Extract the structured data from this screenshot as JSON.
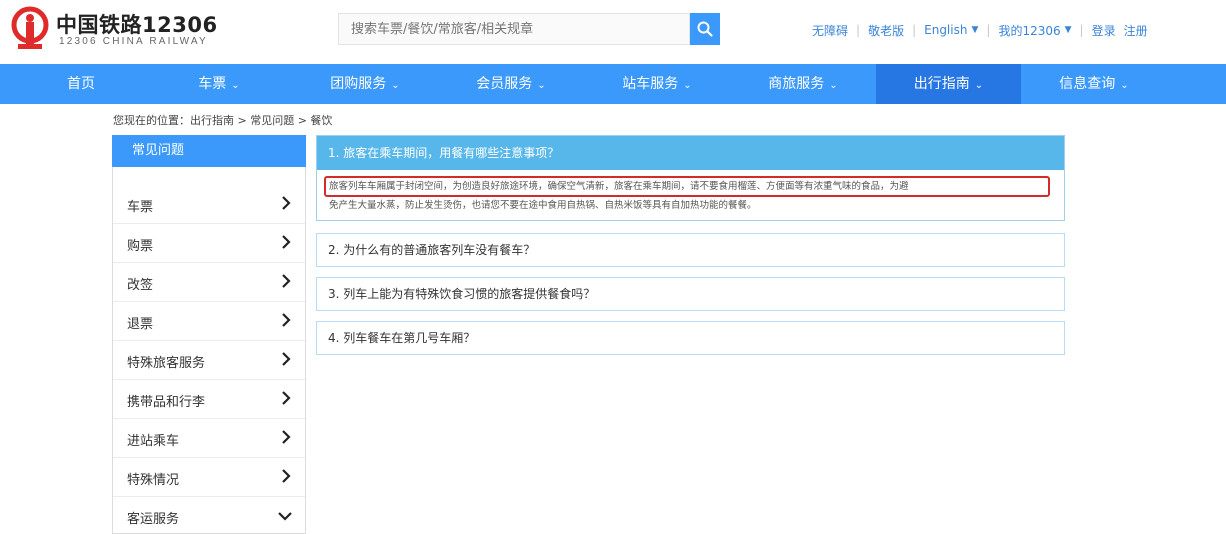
{
  "header": {
    "logo_cn": "中国铁路12306",
    "logo_en": "12306 CHINA RAILWAY",
    "search_placeholder": "搜索车票/餐饮/常旅客/相关规章",
    "links": [
      {
        "label": "无障碍",
        "dropdown": false
      },
      {
        "label": "敬老版",
        "dropdown": false
      },
      {
        "label": "English",
        "dropdown": true
      },
      {
        "label": "我的12306",
        "dropdown": true
      },
      {
        "label": "登录",
        "dropdown": false
      },
      {
        "label": "注册",
        "dropdown": false
      }
    ]
  },
  "nav": {
    "items": [
      {
        "label": "首页",
        "dropdown": false,
        "active": false
      },
      {
        "label": "车票",
        "dropdown": true,
        "active": false
      },
      {
        "label": "团购服务",
        "dropdown": true,
        "active": false
      },
      {
        "label": "会员服务",
        "dropdown": true,
        "active": false
      },
      {
        "label": "站车服务",
        "dropdown": true,
        "active": false
      },
      {
        "label": "商旅服务",
        "dropdown": true,
        "active": false
      },
      {
        "label": "出行指南",
        "dropdown": true,
        "active": true
      },
      {
        "label": "信息查询",
        "dropdown": true,
        "active": false
      }
    ],
    "caret": "⌄"
  },
  "breadcrumb": "您现在的位置：出行指南 > 常见问题 > 餐饮",
  "sidebar": {
    "title": "常见问题",
    "items": [
      {
        "label": "车票",
        "icon": "chevron-right-icon"
      },
      {
        "label": "购票",
        "icon": "chevron-right-icon"
      },
      {
        "label": "改签",
        "icon": "chevron-right-icon"
      },
      {
        "label": "退票",
        "icon": "chevron-right-icon"
      },
      {
        "label": "特殊旅客服务",
        "icon": "chevron-right-icon"
      },
      {
        "label": "携带品和行李",
        "icon": "chevron-right-icon"
      },
      {
        "label": "进站乘车",
        "icon": "chevron-right-icon"
      },
      {
        "label": "特殊情况",
        "icon": "chevron-right-icon"
      },
      {
        "label": "客运服务",
        "icon": "chevron-down-icon"
      }
    ]
  },
  "faq": [
    {
      "question": "1. 旅客在乘车期间，用餐有哪些注意事项？",
      "open": true,
      "answer_line1": "旅客列车车厢属于封闭空间，为创造良好旅途环境，确保空气清新，旅客在乘车期间，请不要食用榴莲、方便面等有浓重气味的食品，为避",
      "answer_line2": "免产生大量水蒸，防止发生烫伤，也请您不要在途中食用自热锅、自热米饭等具有自加热功能的餐餐。"
    },
    {
      "question": "2. 为什么有的普通旅客列车没有餐车？",
      "open": false
    },
    {
      "question": "3. 列车上能为有特殊饮食习惯的旅客提供餐食吗？",
      "open": false
    },
    {
      "question": "4. 列车餐车在第几号车厢？",
      "open": false
    }
  ],
  "colors": {
    "primary": "#3b99fc",
    "nav_active": "#2676e3",
    "faq_open_header": "#58b7ea",
    "highlight": "#d42a2a",
    "logo_red": "#e02b2b"
  }
}
